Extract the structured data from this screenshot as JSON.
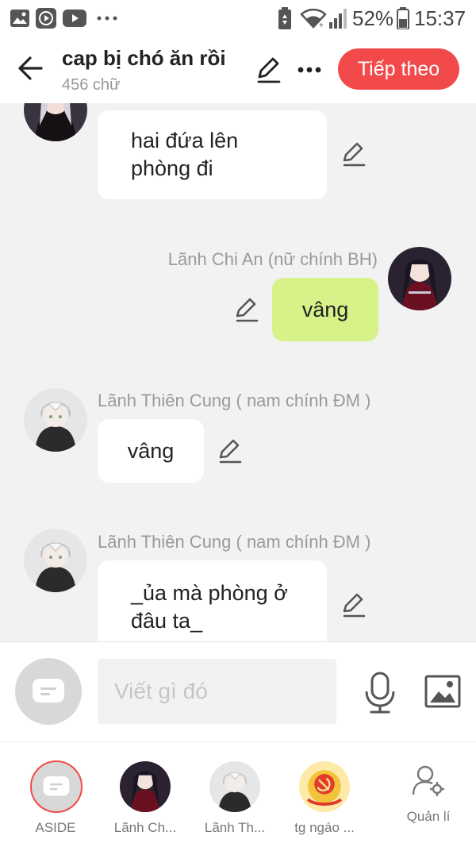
{
  "status_bar": {
    "battery": "52%",
    "time": "15:37",
    "icons": [
      "gallery-icon",
      "youtube-go-icon",
      "youtube-icon",
      "more-dots-icon",
      "battery-saver-icon",
      "wifi-icon",
      "signal-icon",
      "battery-icon"
    ]
  },
  "header": {
    "title": "cap bị chó ăn rồi",
    "word_count": "456 chữ",
    "next_label": "Tiếp theo"
  },
  "messages": [
    {
      "speaker": "",
      "text": [
        "hai đứa lên",
        "phòng đi"
      ],
      "side": "left",
      "bubble_color": "#ffffff"
    },
    {
      "speaker": "Lãnh Chi An (nữ chính BH)",
      "text": [
        "vâng"
      ],
      "side": "right",
      "bubble_color": "#d8f28a"
    },
    {
      "speaker": "Lãnh Thiên Cung ( nam chính ĐM )",
      "text": [
        "vâng"
      ],
      "side": "left",
      "bubble_color": "#ffffff"
    },
    {
      "speaker": "Lãnh Thiên Cung ( nam chính ĐM )",
      "text": [
        "_ủa mà phòng ở",
        "đâu ta_"
      ],
      "side": "left",
      "bubble_color": "#ffffff"
    }
  ],
  "composer": {
    "placeholder": "Viết gì đó"
  },
  "characters": [
    {
      "label": "ASIDE"
    },
    {
      "label": "Lãnh Ch..."
    },
    {
      "label": "Lãnh Th..."
    },
    {
      "label": "tg ngáo ..."
    }
  ],
  "manage_label": "Quản lí",
  "colors": {
    "accent": "#f24a4a",
    "own_bubble": "#d8f28a",
    "background": "#f2f2f2"
  }
}
